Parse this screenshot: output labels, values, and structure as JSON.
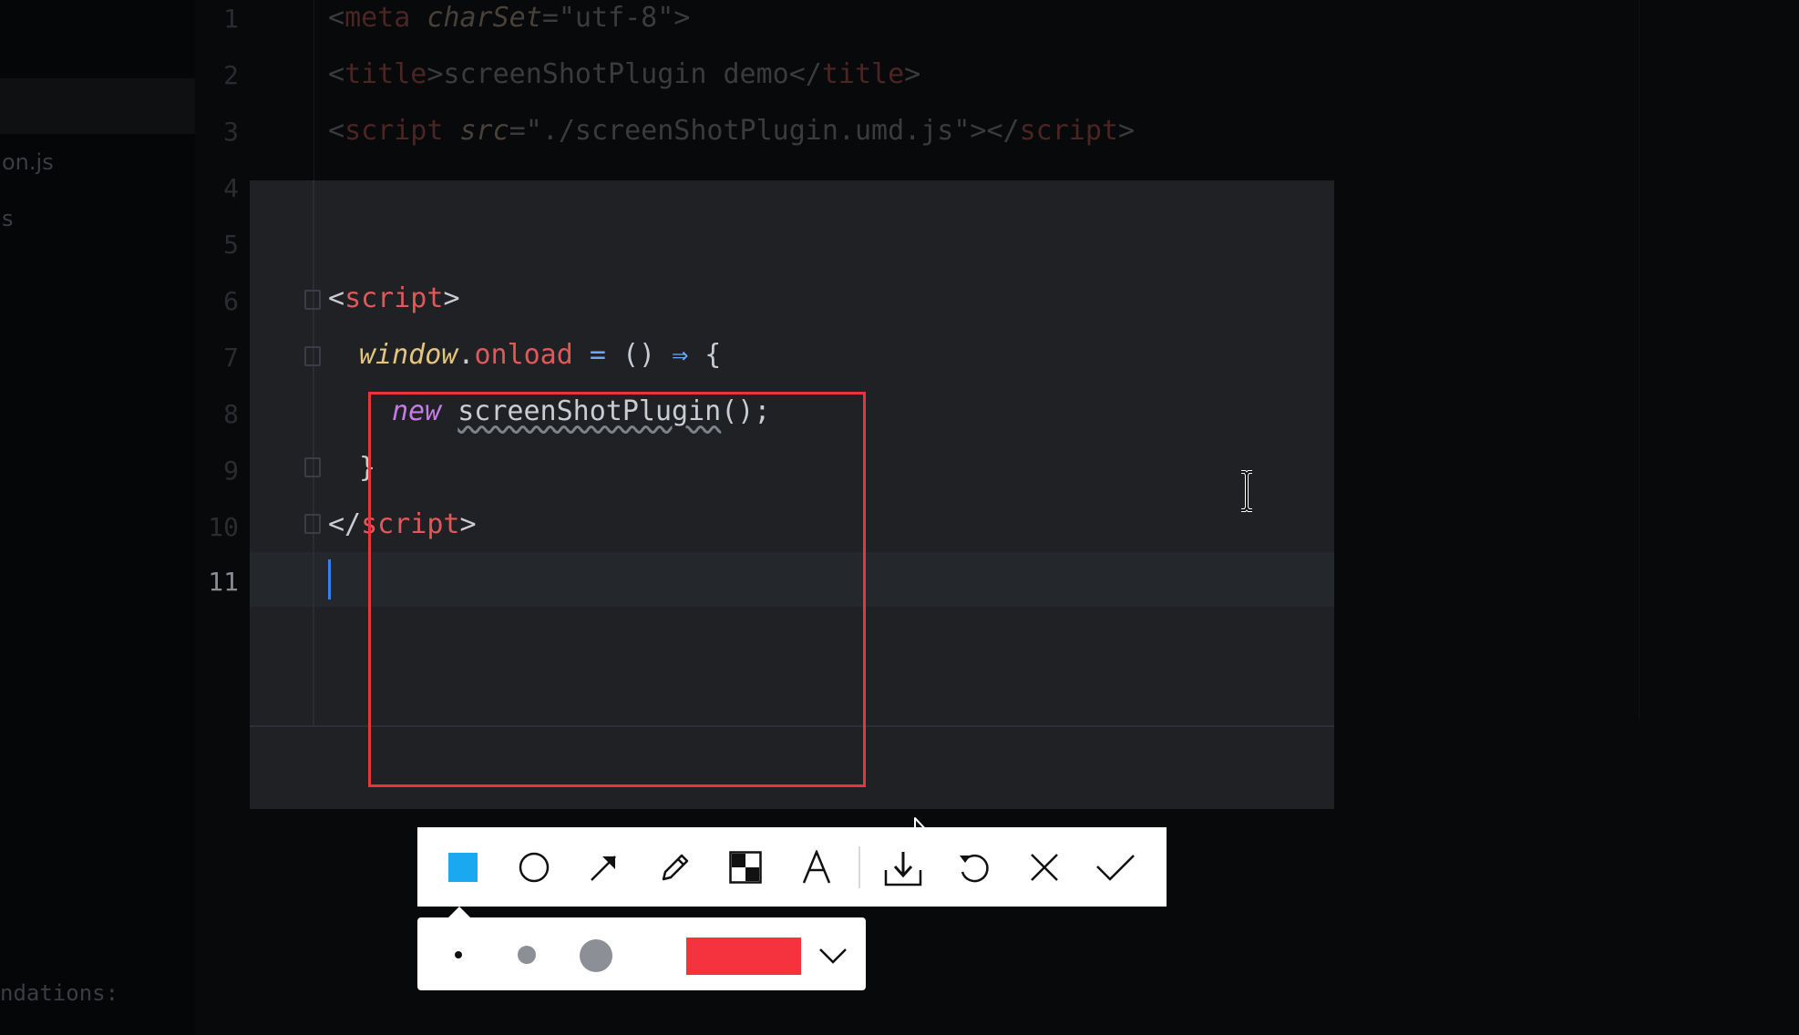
{
  "editor": {
    "left_files": [
      "on.js",
      "s"
    ],
    "line_numbers": [
      "1",
      "2",
      "3",
      "4",
      "5",
      "6",
      "7",
      "8",
      "9",
      "10",
      "11"
    ],
    "dim_lines": {
      "l1_open": "<",
      "l1_tag": "meta",
      "l1_attr": " charSet",
      "l1_rest": "=\"utf-8\">",
      "l2_open": "<",
      "l2_tag": "title",
      "l2_mid": ">screenShotPlugin demo</",
      "l2_tag2": "title",
      "l2_close": ">",
      "l3_open": "<",
      "l3_tag": "script",
      "l3_attr": " src",
      "l3_str": "=\"./screenShotPlugin.umd.js\"></",
      "l3_tag2": "script",
      "l3_close": ">"
    },
    "code": {
      "l6_open": "<",
      "l6_tag": "script",
      "l6_close": ">",
      "l7_obj": "window",
      "l7_dot": ".",
      "l7_prop": "onload",
      "l7_eq": " = ",
      "l7_paren": "() ",
      "l7_arrow": "⇒",
      "l7_brace": " {",
      "l8_kw": "new",
      "l8_fn": "screenShotPlugin",
      "l8_rest": "();",
      "l9": "}",
      "l10_open": "</",
      "l10_tag": "script",
      "l10_close": ">"
    },
    "bottom_text": "ndations:"
  },
  "toolbar": {
    "tools": [
      {
        "name": "rectangle-tool",
        "icon": "filled-square-icon",
        "active": true
      },
      {
        "name": "ellipse-tool",
        "icon": "circle-icon"
      },
      {
        "name": "arrow-tool",
        "icon": "arrow-icon"
      },
      {
        "name": "pencil-tool",
        "icon": "pencil-icon"
      },
      {
        "name": "mosaic-tool",
        "icon": "mosaic-icon"
      },
      {
        "name": "text-tool",
        "icon": "text-icon",
        "label": "A"
      },
      {
        "name": "save-tool",
        "icon": "download-icon"
      },
      {
        "name": "undo-tool",
        "icon": "undo-icon"
      },
      {
        "name": "cancel-tool",
        "icon": "close-icon"
      },
      {
        "name": "confirm-tool",
        "icon": "check-icon"
      }
    ],
    "accent_color": "#1aa9f0"
  },
  "brush_panel": {
    "sizes": [
      "small",
      "medium",
      "large"
    ],
    "selected_color": "#f5333f",
    "dropdown_icon": "chevron-down-icon"
  },
  "annotation": {
    "stroke_color": "#e8343d"
  }
}
